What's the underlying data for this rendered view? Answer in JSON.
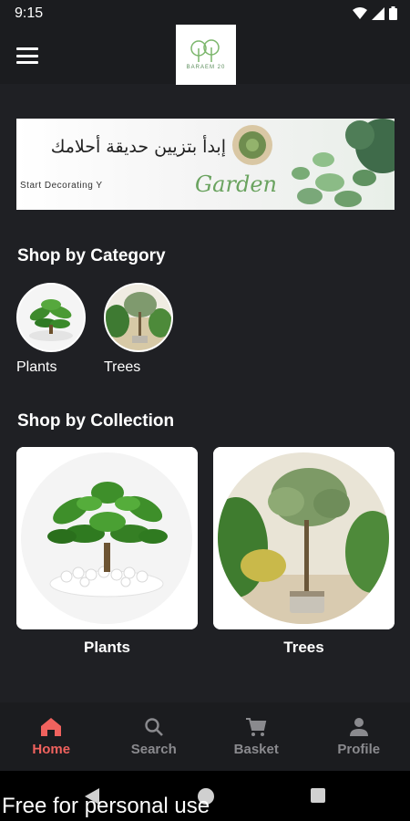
{
  "status_bar": {
    "time": "9:15"
  },
  "app_bar": {
    "logo_text": "BARAEM 20"
  },
  "banner": {
    "arabic_text": "إبدأ بتزيين حديقة أحلامك",
    "english_text": "Start Decorating Y",
    "script_text": "Garden"
  },
  "categories": {
    "title": "Shop by Category",
    "items": [
      {
        "label": "Plants"
      },
      {
        "label": "Trees"
      }
    ]
  },
  "collections": {
    "title": "Shop by Collection",
    "items": [
      {
        "label": "Plants"
      },
      {
        "label": "Trees"
      }
    ]
  },
  "bottom_nav": {
    "items": [
      {
        "label": "Home",
        "icon": "home-icon",
        "active": true
      },
      {
        "label": "Search",
        "icon": "search-icon",
        "active": false
      },
      {
        "label": "Basket",
        "icon": "cart-icon",
        "active": false
      },
      {
        "label": "Profile",
        "icon": "person-icon",
        "active": false
      }
    ]
  },
  "colors": {
    "accent": "#f0625e",
    "background": "#1f2024",
    "bar": "#1b1c1f"
  },
  "watermark": "Free for personal use"
}
